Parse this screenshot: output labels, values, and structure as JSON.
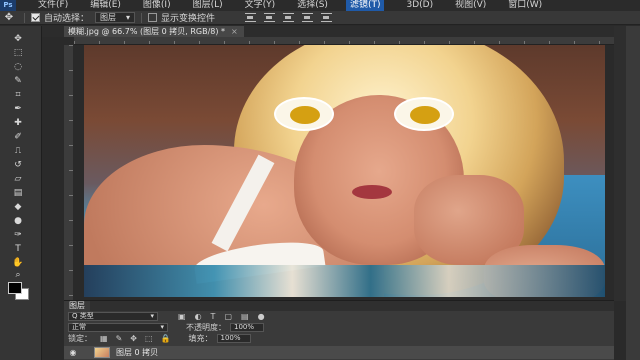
{
  "app": {
    "logo": "Ps"
  },
  "menu": {
    "items": [
      "文件(F)",
      "编辑(E)",
      "图像(I)",
      "图层(L)",
      "文字(Y)",
      "选择(S)",
      "滤镜(T)",
      "3D(D)",
      "视图(V)",
      "窗口(W)"
    ]
  },
  "options": {
    "auto_select_label": "自动选择：",
    "auto_select_checked": true,
    "target_value": "图层",
    "show_transform_label": "显示变换控件",
    "show_transform_checked": false
  },
  "document": {
    "tab_title": "模糊.jpg @ 66.7% (图层 0 拷贝, RGB/8) *",
    "close_glyph": "×"
  },
  "layers": {
    "tab_label": "图层",
    "filter_value": "Q 类型",
    "blend_mode": "正常",
    "opacity_label": "不透明度：",
    "opacity_value": "100%",
    "lock_label": "锁定：",
    "fill_label": "填充：",
    "fill_value": "100%",
    "items": [
      {
        "name": "图层 0 拷贝",
        "visible": true
      }
    ]
  },
  "colors": {
    "menubar_bg": "#2b2b2b",
    "panel_bg": "#3a3a3a",
    "active_menu": "#1f5aa8",
    "foreground_swatch": "#000000",
    "background_swatch": "#ffffff"
  }
}
